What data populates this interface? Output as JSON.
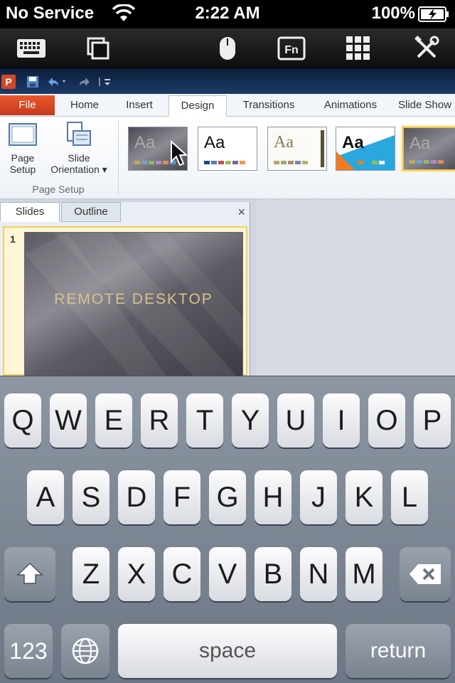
{
  "status_bar": {
    "carrier": "No Service",
    "time": "2:22 AM",
    "battery": "100%"
  },
  "app_toolbar": {
    "icons": [
      "keyboard-icon",
      "windows-icon",
      "mouse-icon",
      "fn-icon",
      "grid-icon",
      "tools-icon"
    ],
    "fn_label": "Fn"
  },
  "powerpoint": {
    "tabs": [
      "File",
      "Home",
      "Insert",
      "Design",
      "Transitions",
      "Animations",
      "Slide Show"
    ],
    "active_tab": "Design",
    "ribbon": {
      "page_setup_label": "Page Setup",
      "page_setup_line1": "Page",
      "page_setup_line2": "Setup",
      "slide_orientation_line1": "Slide",
      "slide_orientation_line2": "Orientation ▾",
      "group_label": "Page Setup",
      "theme_sample_text": "Aa"
    },
    "pane_tabs": [
      "Slides",
      "Outline"
    ],
    "close_glyph": "×",
    "slide_number": "1",
    "slide_title": "REMOTE DESKTOP"
  },
  "keyboard": {
    "row1": [
      "Q",
      "W",
      "E",
      "R",
      "T",
      "Y",
      "U",
      "I",
      "O",
      "P"
    ],
    "row2": [
      "A",
      "S",
      "D",
      "F",
      "G",
      "H",
      "J",
      "K",
      "L"
    ],
    "row3": [
      "Z",
      "X",
      "C",
      "V",
      "B",
      "N",
      "M"
    ],
    "numbers_key": "123",
    "space_key": "space",
    "return_key": "return"
  },
  "colors": {
    "file_tab": "#d24726",
    "slide_title": "#d9c28a",
    "keyboard_bg": "#7d8694"
  }
}
